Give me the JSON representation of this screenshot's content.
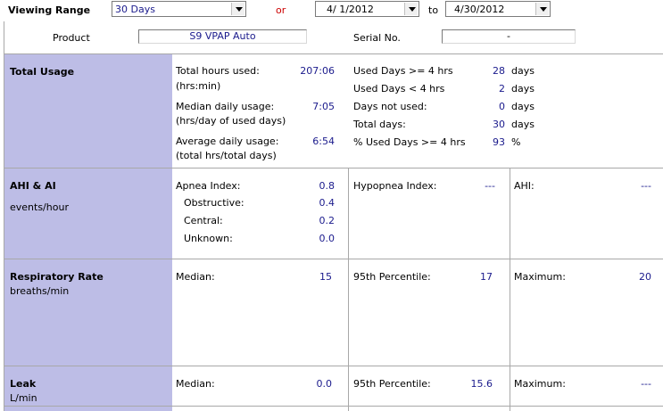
{
  "header": {
    "viewing_range_label": "Viewing Range",
    "range_value": "30 Days",
    "or_label": "or",
    "start_date": "4/  1/2012",
    "to_label": "to",
    "end_date": "4/30/2012"
  },
  "device": {
    "product_label": "Product",
    "product_value": "S9 VPAP Auto",
    "serial_label": "Serial No.",
    "serial_value": "-"
  },
  "usage": {
    "title": "Total Usage",
    "total_hours_label": "Total hours used:",
    "total_hours_sub": "(hrs:min)",
    "total_hours_value": "207:06",
    "median_label": "Median daily usage:",
    "median_sub": "(hrs/day of used days)",
    "median_value": "7:05",
    "average_label": "Average daily usage:",
    "average_sub": "(total hrs/total days)",
    "average_value": "6:54",
    "right": [
      {
        "label": "Used Days >= 4 hrs",
        "value": "28",
        "unit": "days"
      },
      {
        "label": "Used Days < 4 hrs",
        "value": "2",
        "unit": "days"
      },
      {
        "label": "Days not used:",
        "value": "0",
        "unit": "days"
      },
      {
        "label": "Total days:",
        "value": "30",
        "unit": "days"
      },
      {
        "label": "% Used Days >= 4 hrs",
        "value": "93",
        "unit": "%"
      }
    ]
  },
  "ahi": {
    "title": "AHI & AI",
    "unit": "events/hour",
    "apnea_label": "Apnea Index:",
    "apnea_value": "0.8",
    "obstructive_label": "Obstructive:",
    "obstructive_value": "0.4",
    "central_label": "Central:",
    "central_value": "0.2",
    "unknown_label": "Unknown:",
    "unknown_value": "0.0",
    "hypopnea_label": "Hypopnea Index:",
    "hypopnea_value": "---",
    "ahi_label": "AHI:",
    "ahi_value": "---"
  },
  "resp": {
    "title": "Respiratory Rate",
    "unit": "breaths/min",
    "median_label": "Median:",
    "median_value": "15",
    "p95_label": "95th Percentile:",
    "p95_value": "17",
    "max_label": "Maximum:",
    "max_value": "20"
  },
  "leak": {
    "title": "Leak",
    "unit": "L/min",
    "median_label": "Median:",
    "median_value": "0.0",
    "p95_label": "95th Percentile:",
    "p95_value": "15.6",
    "max_label": "Maximum:",
    "max_value": "---"
  }
}
